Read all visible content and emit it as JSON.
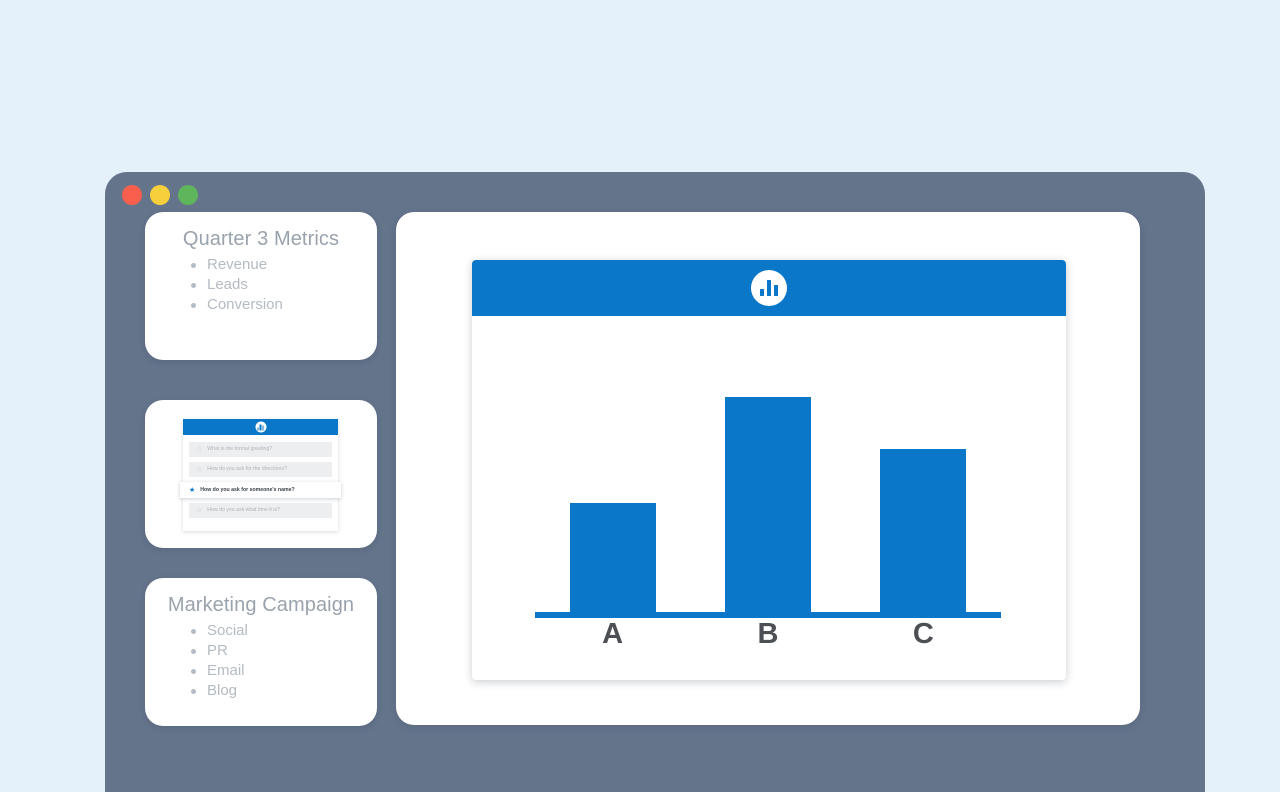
{
  "theme": {
    "page_background": "#e4f0fa",
    "window_frame": "#64748b",
    "accent_blue": "#0a77c8",
    "card_background": "#ffffff",
    "muted_text": "#b4bbc2",
    "title_text": "#9aa3ad",
    "label_text": "#4c5054"
  },
  "titlebar": {
    "close_label": "",
    "minimize_label": "",
    "maximize_label": "",
    "close_color": "#fa5f4e",
    "minimize_color": "#f6cf3c",
    "maximize_color": "#5eb55c"
  },
  "sidebar": {
    "cards": [
      {
        "title": "Quarter 3 Metrics",
        "items": [
          "Revenue",
          "Leads",
          "Conversion"
        ]
      },
      {
        "title": "Marketing Campaign",
        "items": [
          "Social",
          "PR",
          "Email",
          "Blog"
        ]
      }
    ]
  },
  "mini_app": {
    "header_icon": "bar-chart-icon",
    "rows": [
      {
        "text": "What is the formal greeting?",
        "star": "☆",
        "active": false
      },
      {
        "text": "How do you ask for the directions?",
        "star": "☆",
        "active": false
      },
      {
        "text": "How do you ask for someone's name?",
        "star": "★",
        "active": true
      },
      {
        "text": "How do you ask what time it is?",
        "star": "☆",
        "active": false
      }
    ]
  },
  "chart_card": {
    "header_icon": "bar-chart-icon"
  },
  "chart_data": {
    "type": "bar",
    "title": "",
    "subtitle": "",
    "xlabel": "",
    "ylabel": "",
    "categories": [
      "A",
      "B",
      "C"
    ],
    "values": [
      40,
      79,
      60
    ],
    "ylim": [
      0,
      100
    ],
    "grid": false,
    "legend": "none",
    "bar_color": "#0a77c8",
    "axis_color": "#0a77c8",
    "tick_label_color": "#4c5054"
  }
}
